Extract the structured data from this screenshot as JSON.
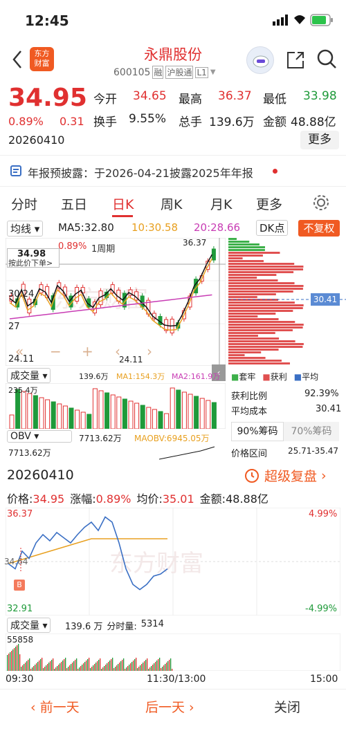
{
  "status": {
    "time": "12:45"
  },
  "header": {
    "logo_text_top": "东方",
    "logo_text_bottom": "财富",
    "stock_name": "永鼎股份",
    "stock_code": "600105",
    "badge1": "融",
    "badge2": "沪股通",
    "badge3": "L1"
  },
  "quote": {
    "price": "34.95",
    "change_pct": "0.89%",
    "change_amt": "0.31",
    "date": "20260410",
    "open_label": "今开",
    "open": "34.65",
    "high_label": "最高",
    "high": "36.37",
    "low_label": "最低",
    "low": "33.98",
    "turnover_label": "换手",
    "turnover": "9.55%",
    "volume_label": "总手",
    "volume": "139.6万",
    "amount_label": "金额",
    "amount": "48.88亿",
    "more_button": "更多"
  },
  "notice": {
    "text": "年报预披露：于2026-04-21披露2025年年报"
  },
  "tabs": [
    "分时",
    "五日",
    "日K",
    "周K",
    "月K",
    "更多"
  ],
  "kline": {
    "indicator_select": "均线",
    "ma5": "MA5:32.80",
    "ma10": "10:30.58",
    "ma20": "20:28.66",
    "dk_button": "DK点",
    "fq_button": "不复权",
    "range_pct": "0.89%",
    "period_label": "1周期",
    "cross_price": "34.98",
    "cross_hint": "按此价下单>",
    "axis_high": "30.24",
    "axis_mid": "27",
    "axis_low": "24.11",
    "max_label": "36.37",
    "min_label": "24.11",
    "chip_price": "30.41",
    "vol_select": "成交量",
    "vol_value": "139.6万",
    "vol_ma1": "MA1:154.3万",
    "vol_ma2": "MA2:161.9万",
    "vol_axis": "235.4万",
    "obv_select": "OBV",
    "obv_value": "7713.62万",
    "obv_ma": "MAOBV:6945.05万",
    "obv_axis": "7713.62万"
  },
  "chips": {
    "legend_trapped": "套牢",
    "legend_profit": "获利",
    "legend_avg": "平均",
    "profit_ratio_label": "获利比例",
    "profit_ratio": "92.39%",
    "avg_cost_label": "平均成本",
    "avg_cost": "30.41",
    "tab90": "90%筹码",
    "tab70": "70%筹码",
    "range_label": "价格区间",
    "range_value": "25.71-35.47"
  },
  "intraday": {
    "date": "20260410",
    "replay_button": "超级复盘",
    "price_label": "价格:",
    "price": "34.95",
    "change_label": "涨幅:",
    "change": "0.89%",
    "avg_label": "均价:",
    "avg": "35.01",
    "amount_label": "金额:",
    "amount": "48.88亿",
    "axis_top": "36.37",
    "axis_bottom": "32.91",
    "pct_top": "4.99%",
    "pct_bottom": "-4.99%",
    "axis_mid": "34.64",
    "vol_select": "成交量",
    "vol_total": "139.6 万",
    "vol_minute_label": "分时量:",
    "vol_minute": "5314",
    "vol_axis": "55858",
    "t_start": "09:30",
    "t_mid": "11:30/13:00",
    "t_end": "15:00",
    "marker": "B"
  },
  "footer": {
    "prev": "前一天",
    "next": "后一天",
    "close": "关闭"
  },
  "colors": {
    "up": "#e03030",
    "down": "#1f9a3a",
    "accent": "#f05a22",
    "blue": "#3a6fc4"
  }
}
